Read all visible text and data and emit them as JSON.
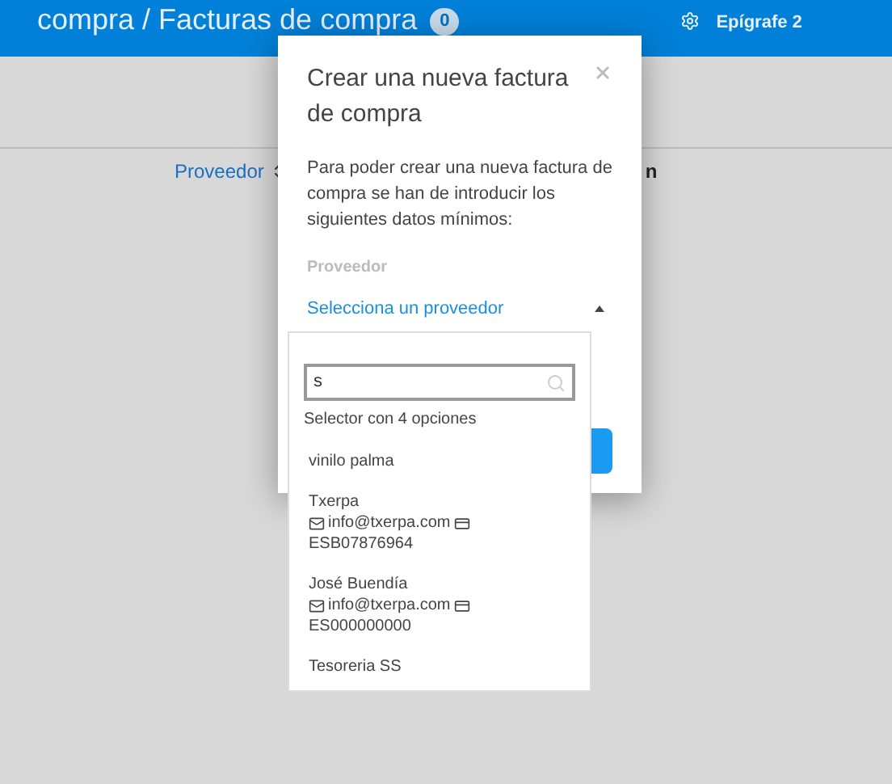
{
  "header": {
    "title": "compra / Facturas de compra",
    "count": "0",
    "settings_label": "Epígrafe 2"
  },
  "table": {
    "columns": [
      {
        "label": "Proveedor",
        "kind": "sortable"
      },
      {
        "label": "n",
        "kind": "plain"
      }
    ]
  },
  "modal": {
    "title": "Crear una nueva factura de compra",
    "message": "Para poder crear una nueva factura de compra se han de introducir los siguientes datos mínimos:",
    "field_label": "Proveedor",
    "select": {
      "placeholder": "Selecciona un proveedor",
      "expanded": true,
      "search_value": "s",
      "result_count": "Selector con 4 opciones",
      "options": [
        {
          "name": "vinilo palma"
        },
        {
          "name": "Txerpa",
          "email": "info@txerpa.com",
          "tax_id": "ESB07876964"
        },
        {
          "name": "José Buendía",
          "email": "info@txerpa.com",
          "tax_id": "ES000000000"
        },
        {
          "name": "Tesoreria SS"
        }
      ]
    }
  }
}
